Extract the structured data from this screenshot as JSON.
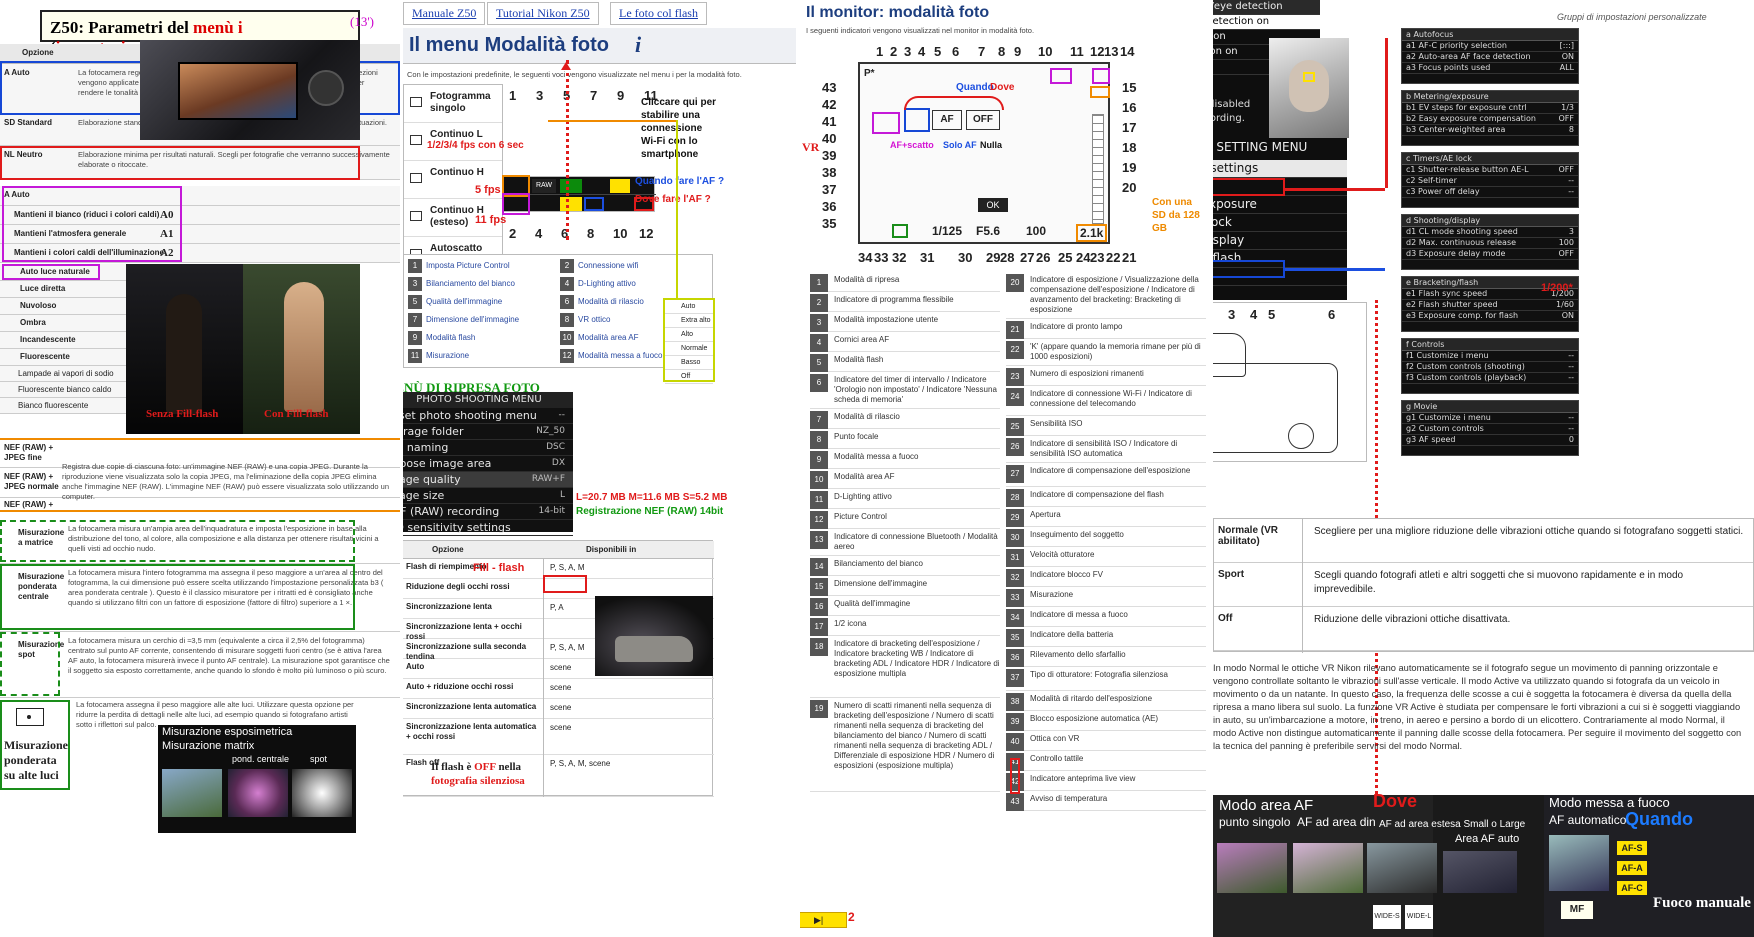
{
  "col1": {
    "title_prefix": "Z50: Parametri del ",
    "title_menu": "menù i",
    "title_open": " (",
    "title_impost": "impostazioni",
    "title_close": ")",
    "title_note": "(13')",
    "opzione": "Opzione",
    "pc_rows": [
      {
        "k": "A Auto",
        "v": "La fotocamera regola le tonalità e le tinte in base al Picture Control standard. Le correzioni vengono applicate automaticamente agli elementi come il Picture Control standard per rendere le tonalità e le immagini scattate."
      },
      {
        "k": "SD Standard",
        "v": "Elaborazione standard per risultati bilanciati. Consigliata per la maggior parte delle situazioni."
      },
      {
        "k": "NL Neutro",
        "v": "Elaborazione minima per risultati naturali. Scegli per fotografie che verranno successivamente elaborate o ritoccate."
      }
    ],
    "wb_auto": "A Auto",
    "wb_items": [
      "Mantieni il bianco (riduci i colori caldi)",
      "Mantieni l'atmosfera generale",
      "Mantieni i colori caldi dell'illuminazione"
    ],
    "wb_codes": [
      "A0",
      "A1",
      "A2"
    ],
    "wb_light": [
      "Auto luce naturale",
      "Luce diretta",
      "Nuvoloso",
      "Ombra",
      "Incandescente",
      "Fluorescente"
    ],
    "wb_fluo": [
      "Lampade ai vapori di sodio",
      "Fluorescente bianco caldo",
      "Bianco fluorescente"
    ],
    "flash_labels": [
      "Senza Fill-flash",
      "Con Fill-flash"
    ],
    "nef_rows": [
      "NEF (RAW) + JPEG fine",
      "NEF (RAW) + JPEG normale",
      "NEF (RAW) +"
    ],
    "nef_desc": "Registra due copie di ciascuna foto: un'immagine NEF (RAW) e una copia JPEG. Durante la riproduzione viene visualizzata solo la copia JPEG, ma l'eliminazione della copia JPEG elimina anche l'immagine NEF (RAW). L'immagine NEF (RAW) può essere visualizzata solo utilizzando un computer.",
    "meter": [
      {
        "k": "Misurazione a matrice",
        "v": "La fotocamera misura un'ampia area dell'inquadratura e imposta l'esposizione in base alla distribuzione del tono, al colore, alla composizione e alla distanza per ottenere risultati vicini a quelli visti ad occhio nudo."
      },
      {
        "k": "Misurazione ponderata centrale",
        "v": "La fotocamera misura l'intero fotogramma ma assegna il peso maggiore a un'area al centro del fotogramma, la cui dimensione può essere scelta utilizzando l'impostazione personalizzata b3 ( area ponderata centrale ). Questo è il classico misuratore per i ritratti ed è consigliato anche quando si utilizzano filtri con un fattore di esposizione (fattore di filtro) superiore a 1 ×."
      },
      {
        "k": "Misurazione spot",
        "v": "La fotocamera misura un cerchio di ≈3,5 mm (equivalente a circa il 2,5% del fotogramma) centrato sul punto AF corrente, consentendo di misurare soggetti fuori centro (se è attiva l'area AF auto, la fotocamera misurerà invece il punto AF centrale). La misurazione spot garantisce che il soggetto sia esposto correttamente, anche quando lo sfondo è molto più luminoso o più scuro."
      }
    ],
    "highlight_label": "Misurazione ponderata su alte luci",
    "highlight_desc": "La fotocamera assegna il peso maggiore alle alte luci. Utilizzare questa opzione per ridurre la perdita di dettagli nelle alte luci, ad esempio quando si fotografano artisti sotto i riflettori sul palco.",
    "meter_panel": {
      "title": "Misurazione esposimetrica",
      "sub": "Misurazione matrix",
      "c2": "pond. centrale",
      "c3": "spot"
    }
  },
  "col2": {
    "tabs": [
      "Manuale Z50",
      "Tutorial Nikon Z50",
      "Le foto col flash"
    ],
    "heading": "Il menu Modalità foto",
    "heading_icon": "i",
    "intro": "Con le impostazioni predefinite, le seguenti voci vengono visualizzate nel menu i per la modalità foto.",
    "release": [
      {
        "k": "Fotogramma singolo",
        "extra": ""
      },
      {
        "k": "Continuo L",
        "extra": "1/2/3/4 fps con 6 sec"
      },
      {
        "k": "Continuo H",
        "extra": "5 fps"
      },
      {
        "k": "Continuo H (esteso)",
        "extra": "11 fps"
      },
      {
        "k": "Autoscatto",
        "extra": ""
      }
    ],
    "top_nums": [
      "1",
      "3",
      "5",
      "7",
      "9",
      "11"
    ],
    "bot_nums": [
      "2",
      "4",
      "6",
      "8",
      "10",
      "12"
    ],
    "wifi_note": "Cliccare qui per stabilire una connessione Wi-Fi con lo smartphone",
    "q_when": "Quando fare l'AF ?",
    "q_where": "Dove fare l'AF ?",
    "legend_left": [
      "Imposta Picture Control",
      "Bilanciamento del bianco",
      "Qualità dell'immagine",
      "Dimensione dell'immagine",
      "Modalità flash",
      "Misurazione"
    ],
    "legend_right": [
      "Connessione wifi",
      "D-Lighting attivo",
      "Modalità di rilascio",
      "VR ottico",
      "Modalità area AF",
      "Modalità messa a fuoco"
    ],
    "release_popup": [
      "Auto",
      "Extra alto",
      "Alto",
      "Normale",
      "Basso",
      "Off"
    ],
    "shoot_menu_title": "MENÙ DI RIPRESA FOTO",
    "psm": {
      "header": "PHOTO SHOOTING MENU",
      "items": [
        {
          "k": "Reset photo shooting menu",
          "v": "--"
        },
        {
          "k": "Storage folder",
          "v": "NZ_50"
        },
        {
          "k": "File naming",
          "v": "DSC"
        },
        {
          "k": "Choose image area",
          "v": "DX"
        },
        {
          "k": "Image quality",
          "v": "RAW+F"
        },
        {
          "k": "Image size",
          "v": "L"
        },
        {
          "k": "NEF (RAW) recording",
          "v": "14-bit"
        },
        {
          "k": "ISO sensitivity settings",
          "v": ""
        }
      ]
    },
    "size_note": "L=20.7 MB M=11.6 MB S=5.2 MB",
    "raw_note": "Registrazione NEF (RAW) 14bit",
    "flash_hdr": [
      "Opzione",
      "Disponibili in"
    ],
    "flash_rows": [
      {
        "k": "Flash di riempimento",
        "v": "P, S, A, M"
      },
      {
        "k": "Riduzione degli occhi rossi",
        "v": ""
      },
      {
        "k": "Sincronizzazione lenta",
        "v": "P, A"
      },
      {
        "k": "Sincronizzazione lenta + occhi rossi",
        "v": ""
      },
      {
        "k": "Sincronizzazione sulla seconda tendina",
        "v": "P, S, A, M"
      },
      {
        "k": "Auto",
        "v": "scene"
      },
      {
        "k": "Auto + riduzione occhi rossi",
        "v": "scene"
      },
      {
        "k": "Sincronizzazione lenta automatica",
        "v": "scene"
      },
      {
        "k": "Sincronizzazione lenta automatica + occhi rossi",
        "v": "scene"
      },
      {
        "k": "Flash off",
        "v": "P, S, A, M, scene"
      }
    ],
    "fill_flash": "Fill - flash",
    "flash_off_note1": "Il flash è ",
    "flash_off_note2": "OFF",
    "flash_off_note3": " nella",
    "flash_off_note4": "fotografia silenziosa"
  },
  "col3": {
    "heading": "Il monitor: modalità foto",
    "intro": "I seguenti indicatori vengono visualizzati nel monitor in modalità foto.",
    "quando": "Quando",
    "dove": "Dove",
    "vr": "VR",
    "af_scatto": "AF+scatto",
    "solo_af": "Solo AF",
    "nulla": "Nulla",
    "sd_note": "Con una SD da 128 GB",
    "nav_page": "2",
    "legend_a": [
      [
        "1",
        "Modalità di ripresa"
      ],
      [
        "2",
        "Indicatore di programma flessibile"
      ],
      [
        "3",
        "Modalità impostazione utente"
      ],
      [
        "4",
        "Cornici area AF"
      ],
      [
        "5",
        "Modalità flash"
      ],
      [
        "6",
        "Indicatore del timer di intervallo / Indicatore 'Orologio non impostato' / Indicatore 'Nessuna scheda di memoria'"
      ],
      [
        "7",
        "Modalità di rilascio"
      ],
      [
        "8",
        "Punto focale"
      ],
      [
        "9",
        "Modalità messa a fuoco"
      ],
      [
        "10",
        "Modalità area AF"
      ],
      [
        "11",
        "D-Lighting attivo"
      ],
      [
        "12",
        "Picture Control"
      ],
      [
        "13",
        "Indicatore di connessione Bluetooth / Modalità aereo"
      ],
      [
        "14",
        "Bilanciamento del bianco"
      ],
      [
        "15",
        "Dimensione dell'immagine"
      ],
      [
        "16",
        "Qualità dell'immagine"
      ],
      [
        "17",
        "1/2 icona"
      ],
      [
        "18",
        "Indicatore di bracketing dell'esposizione / Indicatore bracketing WB / Indicatore di bracketing ADL / Indicatore HDR / Indicatore di esposizione multipla"
      ],
      [
        "19",
        "Numero di scatti rimanenti nella sequenza di bracketing dell'esposizione / Numero di scatti rimanenti nella sequenza di bracketing del bilanciamento del bianco / Numero di scatti rimanenti nella sequenza di bracketing ADL / Differenziale di esposizione HDR / Numero di esposizioni (esposizione multipla)"
      ]
    ],
    "legend_b": [
      [
        "20",
        "Indicatore di esposizione / Visualizzazione della compensazione dell'esposizione / Indicatore di avanzamento del bracketing: Bracketing di esposizione"
      ],
      [
        "21",
        "Indicatore di pronto lampo"
      ],
      [
        "22",
        "'K' (appare quando la memoria rimane per più di 1000 esposizioni)"
      ],
      [
        "23",
        "Numero di esposizioni rimanenti"
      ],
      [
        "24",
        "Indicatore di connessione Wi-Fi / Indicatore di connessione del telecomando"
      ],
      [
        "25",
        "Sensibilità ISO"
      ],
      [
        "26",
        "Indicatore di sensibilità ISO / Indicatore di sensibilità ISO automatica"
      ],
      [
        "27",
        "Indicatore di compensazione dell'esposizione"
      ],
      [
        "28",
        "Indicatore di compensazione del flash"
      ],
      [
        "29",
        "Apertura"
      ],
      [
        "30",
        "Inseguimento del soggetto"
      ],
      [
        "31",
        "Velocità otturatore"
      ],
      [
        "32",
        "Indicatore blocco FV"
      ],
      [
        "33",
        "Misurazione"
      ],
      [
        "34",
        "Indicatore di messa a fuoco"
      ],
      [
        "35",
        "Indicatore della batteria"
      ],
      [
        "36",
        "Rilevamento dello sfarfallio"
      ],
      [
        "37",
        "Tipo di otturatore: Fotografia silenziosa"
      ],
      [
        "38",
        "Modalità di ritardo dell'esposizione"
      ],
      [
        "39",
        "Blocco esposizione automatica (AE)"
      ],
      [
        "40",
        "Ottica con VR"
      ],
      [
        "41",
        "Controllo tattile"
      ],
      [
        "42",
        "Indicatore anteprima live view"
      ],
      [
        "43",
        "Avviso di temperatura"
      ]
    ],
    "ottica_vr": "Ottica con VR",
    "controllo_tattile": "Controllo tattile",
    "lcd": {
      "shutter": "1/125",
      "aperture": "F5.6",
      "iso": "100",
      "count": "2.1k",
      "ok": "OK"
    }
  },
  "col4": {
    "face_menu": [
      "Auto-area AF face/eye detection",
      "Face and eye detection on",
      "Face detection on",
      "Animal detection on",
      "Off"
    ],
    "face_note": "Eye detection is disabled during movie recording.",
    "gruppi": "Gruppi di impostazioni personalizzate",
    "csm_title": "CUSTOM SETTING MENU",
    "csm_items": [
      "Reset custom settings",
      "a Autofocus",
      "b Metering/exposure",
      "c Timers/AE lock",
      "d Shooting/display",
      "e Bracketing/flash",
      "f Controls",
      "g Movie"
    ],
    "groups": [
      {
        "t": "a Autofocus",
        "l": [
          [
            "a1 AF-C priority selection",
            "[:::]"
          ],
          [
            "a2 Auto-area AF face detection",
            "ON"
          ],
          [
            "a3 Focus points used",
            "ALL"
          ]
        ]
      },
      {
        "t": "b Metering/exposure",
        "l": [
          [
            "b1 EV steps for exposure cntrl",
            "1/3"
          ],
          [
            "b2 Easy exposure compensation",
            "OFF"
          ],
          [
            "b3 Center-weighted area",
            "8"
          ]
        ]
      },
      {
        "t": "c Timers/AE lock",
        "l": [
          [
            "c1 Shutter-release button AE-L",
            "OFF"
          ],
          [
            "c2 Self-timer",
            "--"
          ],
          [
            "c3 Power off delay",
            "--"
          ]
        ]
      },
      {
        "t": "d Shooting/display",
        "l": [
          [
            "d1 CL mode shooting speed",
            "3"
          ],
          [
            "d2 Max. continuous release",
            "100"
          ],
          [
            "d3 Exposure delay mode",
            "OFF"
          ]
        ]
      },
      {
        "t": "e Bracketing/flash",
        "l": [
          [
            "e1 Flash sync speed",
            "1/200"
          ],
          [
            "e2 Flash shutter speed",
            "1/60"
          ],
          [
            "e3 Exposure comp. for flash",
            "ON"
          ]
        ]
      },
      {
        "t": "f Controls",
        "l": [
          [
            "f1 Customize i menu",
            "--"
          ],
          [
            "f2 Custom controls (shooting)",
            "--"
          ],
          [
            "f3 Custom controls (playback)",
            "--"
          ]
        ]
      },
      {
        "t": "g Movie",
        "l": [
          [
            "g1 Customize i menu",
            "--"
          ],
          [
            "g2 Custom controls",
            "--"
          ],
          [
            "g3 AF speed",
            "0"
          ]
        ]
      }
    ],
    "flash_sync_note": "1/200*",
    "cam_nums": [
      "1",
      "2",
      "3",
      "4",
      "5",
      "6"
    ],
    "vr_rows": [
      {
        "k": "Normale (VR abilitato)",
        "v": "Scegliere per una migliore riduzione delle vibrazioni ottiche quando si fotografano soggetti statici."
      },
      {
        "k": "Sport",
        "v": "Scegli quando fotografi atleti e altri soggetti che si muovono rapidamente e in modo imprevedibile."
      },
      {
        "k": "Off",
        "v": "Riduzione delle vibrazioni ottiche disattivata."
      }
    ],
    "vr_para": "In modo Normal le ottiche VR Nikon rilevano automaticamente se il fotografo segue un movimento di panning orizzontale e vengono controllate soltanto le vibrazioni sull'asse verticale. Il modo Active va utilizzato quando si fotografa da un veicolo in movimento o da un natante. In questo caso, la frequenza delle scosse a cui è soggetta la fotocamera è diversa da quella della ripresa a mano libera sul suolo. La funzione VR Active è studiata per compensare le forti vibrazioni a cui si è soggetti viaggiando in auto, su un'imbarcazione a motore, in treno, in aereo e persino a bordo di un elicottero. Contrariamente al modo Normal, il modo Active non distingue automaticamente il panning dalle scosse della fotocamera. Per seguire il movimento del soggetto con la tecnica del panning è preferibile servirsi del modo Normal.",
    "af_area": {
      "title": "Modo area AF",
      "dove": "Dove",
      "single": "punto singolo",
      "dyn": "AF ad area din",
      "wide": "AF ad area estesa Small o Large",
      "auto": "Area AF auto",
      "w1": "WIDE-S",
      "w2": "WIDE-L"
    },
    "focus_mode": {
      "title": "Modo messa a fuoco",
      "auto": "AF automatico",
      "quando": "Quando",
      "afs": "AF-S",
      "afa": "AF-A",
      "afc": "AF-C",
      "mf": "MF",
      "fuoco": "Fuoco manuale"
    }
  }
}
